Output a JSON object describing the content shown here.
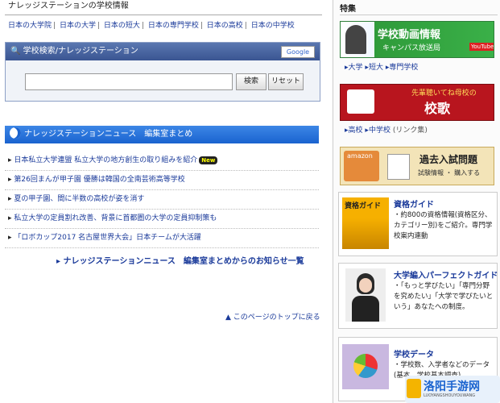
{
  "header": {
    "title": "ナレッジステーションの学校情報"
  },
  "school_nav": [
    "日本の大学院",
    "日本の大学",
    "日本の短大",
    "日本の専門学校",
    "日本の高校",
    "日本の中学校"
  ],
  "search": {
    "title": "学校検索/ナレッジステーション",
    "google_label": "Google",
    "input_value": "",
    "search_button": "検索",
    "reset_button": "リセット"
  },
  "news": {
    "title": "ナレッジステーションニュース　編集室まとめ",
    "items": [
      {
        "text": "日本私立大学連盟 私立大学の地方創生の取り組みを紹介",
        "badge": "New"
      },
      {
        "text": "第26回まんが甲子園 優勝は韓国の全南芸術高等学校"
      },
      {
        "text": "夏の甲子園、間に半数の高校が姿を消す"
      },
      {
        "text": "私立大学の定員割れ改善、背景に首都圏の大学の定員抑制策も"
      },
      {
        "text": "「ロボカップ2017 名古屋世界大会」日本チームが大活躍"
      }
    ],
    "more_link": "ナレッジステーションニュース　編集室まとめからのお知らせ一覧",
    "back_to_top": "このページのトップに戻る"
  },
  "sidebar": {
    "title": "特集",
    "banner1": {
      "title": "学校動画情報",
      "subtitle": "キャンパス放送局",
      "badge": "YouTube"
    },
    "links1": [
      "大学",
      "短大",
      "専門学校"
    ],
    "banner2": {
      "title": "校歌",
      "subtitle": "先輩聴いてね母校の"
    },
    "links2": [
      "高校",
      "中学校",
      "(リンク集)"
    ],
    "banner3": {
      "brand": "amazon",
      "title": "過去入試問題",
      "subtitle": "試験情報 ・ 購入する"
    },
    "card1": {
      "title": "資格ガイド",
      "image_label": "資格ガイド",
      "text": "・約800の資格情報(資格区分、カテゴリー別)をご紹介。専門学校案内連動"
    },
    "card2": {
      "title": "大学編入パーフェクトガイド",
      "text": "・「もっと学びたい」「専門分野を究めたい」「大学で学びたいという」あなたへの制度。"
    },
    "card3": {
      "title": "学校データ",
      "text": "・学校数、入学者などのデータ(基本、学校基本調査)"
    }
  },
  "watermark": {
    "text": "洛阳手游网",
    "subtext": "LUOYANGSHOUYOUWANG"
  },
  "colors": {
    "link": "#1a3a9a",
    "news_header": "#1a63cf",
    "search_header": "#3a5592"
  }
}
